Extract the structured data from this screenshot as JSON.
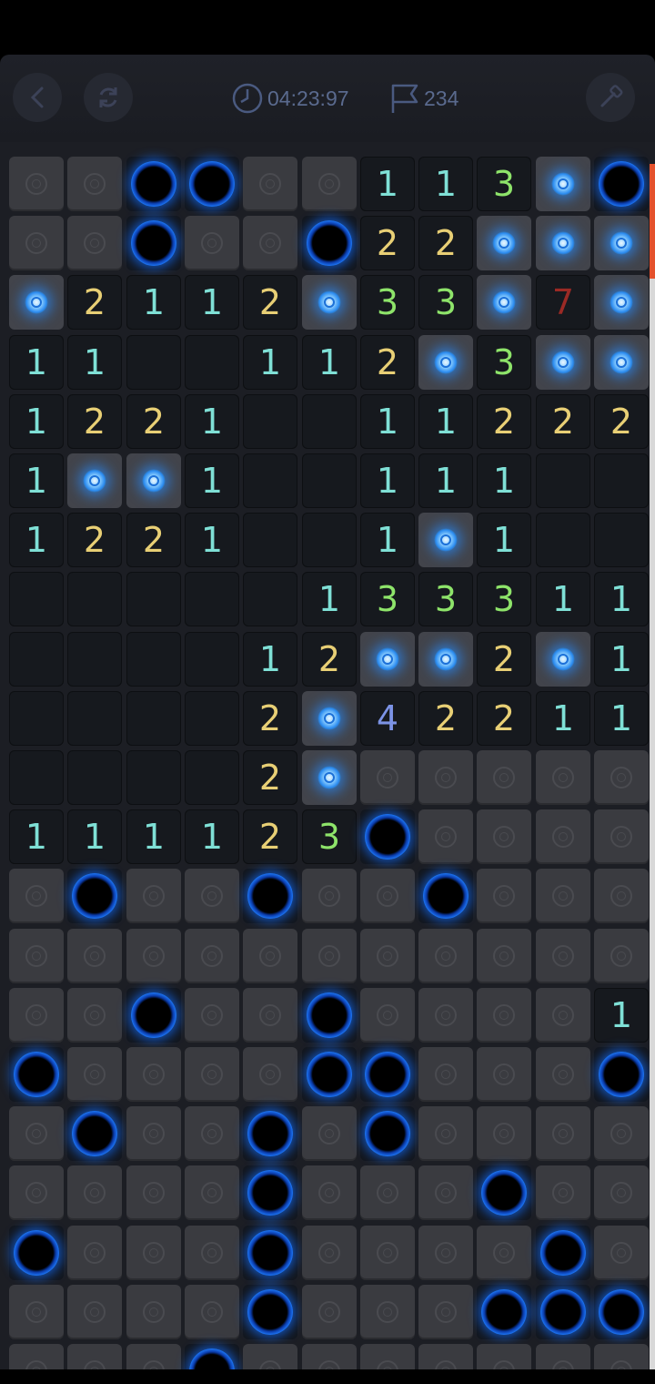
{
  "header": {
    "timer": "04:23:97",
    "flags": "234",
    "icons": {
      "back": "chevron-left-icon",
      "restart": "refresh-icon",
      "timer": "clock-icon",
      "flags": "flag-icon",
      "tool": "hammer-icon"
    }
  },
  "colors": {
    "1": "#7fe0d6",
    "2": "#e8cf75",
    "3": "#8ee46a",
    "4": "#7c93e6",
    "7": "#9b2a25",
    "accent": "#1f7dff"
  },
  "board": {
    "columns": 11,
    "legend": "H=hidden, F=glowing rose marker, M=mine ring, .=empty revealed, digit=count",
    "rows": [
      [
        "H",
        "H",
        "M",
        "M",
        "H",
        "H",
        "1",
        "1",
        "3",
        "F",
        "M"
      ],
      [
        "H",
        "H",
        "M",
        "H",
        "H",
        "M",
        "2",
        "2",
        "F",
        "F",
        "F"
      ],
      [
        "F",
        "2",
        "1",
        "1",
        "2",
        "F",
        "3",
        "3",
        "F",
        "7",
        "F"
      ],
      [
        "1",
        "1",
        ".",
        ".",
        "1",
        "1",
        "2",
        "F",
        "3",
        "F",
        "F"
      ],
      [
        "1",
        "2",
        "2",
        "1",
        ".",
        ".",
        "1",
        "1",
        "2",
        "2",
        "2"
      ],
      [
        "1",
        "F",
        "F",
        "1",
        ".",
        ".",
        "1",
        "1",
        "1",
        ".",
        "."
      ],
      [
        "1",
        "2",
        "2",
        "1",
        ".",
        ".",
        "1",
        "F",
        "1",
        ".",
        "."
      ],
      [
        ".",
        ".",
        ".",
        ".",
        ".",
        "1",
        "3",
        "3",
        "3",
        "1",
        "1"
      ],
      [
        ".",
        ".",
        ".",
        ".",
        "1",
        "2",
        "F",
        "F",
        "2",
        "F",
        "1"
      ],
      [
        ".",
        ".",
        ".",
        ".",
        "2",
        "F",
        "4",
        "2",
        "2",
        "1",
        "1"
      ],
      [
        ".",
        ".",
        ".",
        ".",
        "2",
        "F",
        "H",
        "H",
        "H",
        "H",
        "H"
      ],
      [
        "1",
        "1",
        "1",
        "1",
        "2",
        "3",
        "M",
        "H",
        "H",
        "H",
        "H"
      ],
      [
        "H",
        "M",
        "H",
        "H",
        "M",
        "H",
        "H",
        "M",
        "H",
        "H",
        "H"
      ],
      [
        "H",
        "H",
        "H",
        "H",
        "H",
        "H",
        "H",
        "H",
        "H",
        "H",
        "H"
      ],
      [
        "H",
        "H",
        "M",
        "H",
        "H",
        "M",
        "H",
        "H",
        "H",
        "H",
        "1"
      ],
      [
        "M",
        "H",
        "H",
        "H",
        "H",
        "M",
        "M",
        "H",
        "H",
        "H",
        "M"
      ],
      [
        "H",
        "M",
        "H",
        "H",
        "M",
        "H",
        "M",
        "H",
        "H",
        "H",
        "H"
      ],
      [
        "H",
        "H",
        "H",
        "H",
        "M",
        "H",
        "H",
        "H",
        "M",
        "H",
        "H"
      ],
      [
        "M",
        "H",
        "H",
        "H",
        "M",
        "H",
        "H",
        "H",
        "H",
        "M",
        "H"
      ],
      [
        "H",
        "H",
        "H",
        "H",
        "M",
        "H",
        "H",
        "H",
        "M",
        "M",
        "M"
      ],
      [
        "H",
        "H",
        "H",
        "M",
        "H",
        "H",
        "H",
        "H",
        "H",
        "H",
        "H"
      ]
    ]
  }
}
